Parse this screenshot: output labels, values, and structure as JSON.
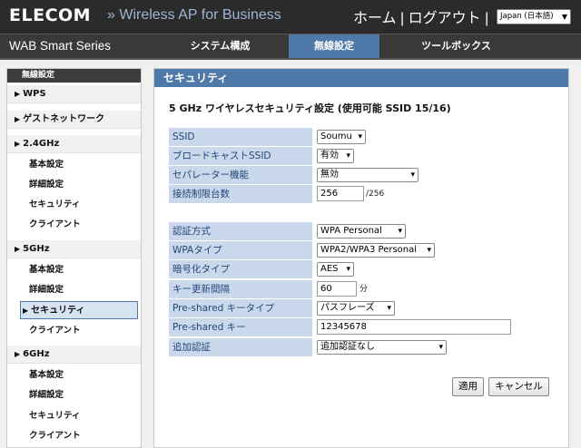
{
  "header": {
    "logo": "ELECOM",
    "product": "» Wireless AP for Business",
    "home": "ホーム",
    "sep": "|",
    "logout": "ログアウト",
    "sep2": "|",
    "language": "Japan (日本語)"
  },
  "nav": {
    "series": "WAB Smart Series",
    "tabs": [
      "システム構成",
      "無線設定",
      "ツールボックス"
    ],
    "active_tab": "無線設定"
  },
  "sidebar": {
    "heading": "無線設定",
    "items": [
      {
        "label": "WPS",
        "type": "section"
      },
      {
        "label": "ゲストネットワーク",
        "type": "section"
      },
      {
        "label": "2.4GHz",
        "type": "section"
      },
      {
        "label": "基本設定",
        "type": "sub"
      },
      {
        "label": "詳細設定",
        "type": "sub"
      },
      {
        "label": "セキュリティ",
        "type": "sub"
      },
      {
        "label": "クライアント",
        "type": "sub"
      },
      {
        "label": "5GHz",
        "type": "section"
      },
      {
        "label": "基本設定",
        "type": "sub"
      },
      {
        "label": "詳細設定",
        "type": "sub"
      },
      {
        "label": "セキュリティ",
        "type": "sub",
        "active": true
      },
      {
        "label": "クライアント",
        "type": "sub"
      },
      {
        "label": "6GHz",
        "type": "section"
      },
      {
        "label": "基本設定",
        "type": "sub"
      },
      {
        "label": "詳細設定",
        "type": "sub"
      },
      {
        "label": "セキュリティ",
        "type": "sub"
      },
      {
        "label": "クライアント",
        "type": "sub"
      }
    ]
  },
  "content": {
    "heading": "セキュリティ",
    "title": "5 GHz ワイヤレスセキュリティ設定 (使用可能 SSID 15/16)",
    "group1": {
      "ssid": {
        "label": "SSID",
        "value": "Soumu"
      },
      "broadcast": {
        "label": "ブロードキャストSSID",
        "value": "有効"
      },
      "separator": {
        "label": "セパレーター機能",
        "value": "無効"
      },
      "max_clients": {
        "label": "接続制限台数",
        "value": "256",
        "suffix": "/256"
      }
    },
    "group2": {
      "auth": {
        "label": "認証方式",
        "value": "WPA Personal"
      },
      "wpa_type": {
        "label": "WPAタイプ",
        "value": "WPA2/WPA3 Personal"
      },
      "encryption": {
        "label": "暗号化タイプ",
        "value": "AES"
      },
      "key_interval": {
        "label": "キー更新間隔",
        "value": "60",
        "suffix": "分"
      },
      "psk_type": {
        "label": "Pre-shared キータイプ",
        "value": "パスフレーズ"
      },
      "psk": {
        "label": "Pre-shared キー",
        "value": "12345678"
      },
      "extra_auth": {
        "label": "追加認証",
        "value": "追加認証なし"
      }
    },
    "buttons": {
      "apply": "適用",
      "cancel": "キャンセル"
    }
  },
  "colors": {
    "accent": "#4f79a8",
    "label_bg": "#c9d8ea",
    "label_text": "#23467a",
    "topbar": "#2b2b2b"
  }
}
